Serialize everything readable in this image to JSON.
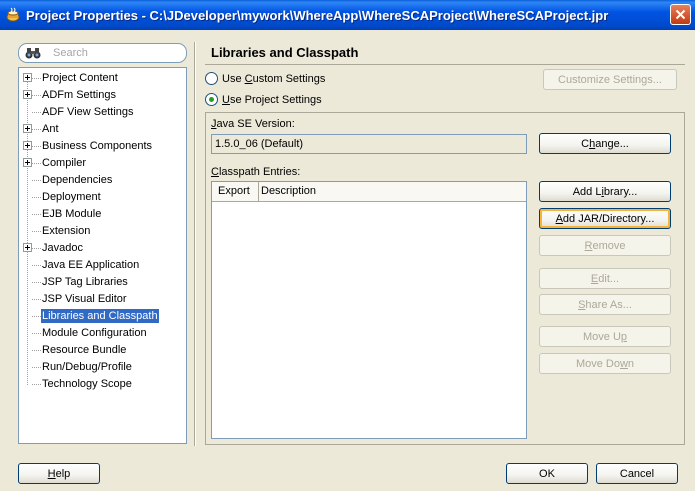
{
  "window": {
    "title": "Project Properties - C:\\JDeveloper\\mywork\\WhereApp\\WhereSCAProject\\WhereSCAProject.jpr"
  },
  "search": {
    "placeholder": "Search"
  },
  "tree": {
    "items": [
      {
        "label": "Project Content",
        "expandable": true
      },
      {
        "label": "ADFm Settings",
        "expandable": true
      },
      {
        "label": "ADF View Settings",
        "expandable": false
      },
      {
        "label": "Ant",
        "expandable": true
      },
      {
        "label": "Business Components",
        "expandable": true
      },
      {
        "label": "Compiler",
        "expandable": true
      },
      {
        "label": "Dependencies",
        "expandable": false
      },
      {
        "label": "Deployment",
        "expandable": false
      },
      {
        "label": "EJB Module",
        "expandable": false
      },
      {
        "label": "Extension",
        "expandable": false
      },
      {
        "label": "Javadoc",
        "expandable": true
      },
      {
        "label": "Java EE Application",
        "expandable": false
      },
      {
        "label": "JSP Tag Libraries",
        "expandable": false
      },
      {
        "label": "JSP Visual Editor",
        "expandable": false
      },
      {
        "label": "Libraries and Classpath",
        "expandable": false,
        "selected": true
      },
      {
        "label": "Module Configuration",
        "expandable": false
      },
      {
        "label": "Resource Bundle",
        "expandable": false
      },
      {
        "label": "Run/Debug/Profile",
        "expandable": false
      },
      {
        "label": "Technology Scope",
        "expandable": false
      }
    ]
  },
  "panel": {
    "title": "Libraries and Classpath",
    "use_custom_settings": {
      "pre": "Use ",
      "key": "C",
      "post": "ustom Settings"
    },
    "use_project_settings": {
      "pre": "",
      "key": "U",
      "post": "se Project Settings"
    },
    "customize_button": "Customize Settings...",
    "java_se_label": {
      "pre": "",
      "key": "J",
      "post": "ava SE Version:"
    },
    "java_se_value": "1.5.0_06 (Default)",
    "change_button": {
      "pre": "C",
      "key": "h",
      "post": "ange..."
    },
    "classpath_label": {
      "pre": "",
      "key": "C",
      "post": "lasspath Entries:"
    },
    "columns": {
      "export": "Export",
      "description": "Description"
    },
    "buttons": {
      "add_library": {
        "pre": "Add L",
        "key": "i",
        "post": "brary..."
      },
      "add_jar": {
        "pre": "",
        "key": "A",
        "post": "dd JAR/Directory..."
      },
      "remove": {
        "pre": "",
        "key": "R",
        "post": "emove"
      },
      "edit": {
        "pre": "",
        "key": "E",
        "post": "dit..."
      },
      "share_as": {
        "pre": "",
        "key": "S",
        "post": "hare As..."
      },
      "move_up": {
        "pre": "Move U",
        "key": "p",
        "post": ""
      },
      "move_down": {
        "pre": "Move Do",
        "key": "w",
        "post": "n"
      }
    }
  },
  "footer": {
    "help": {
      "pre": "",
      "key": "H",
      "post": "elp"
    },
    "ok": "OK",
    "cancel": "Cancel"
  }
}
